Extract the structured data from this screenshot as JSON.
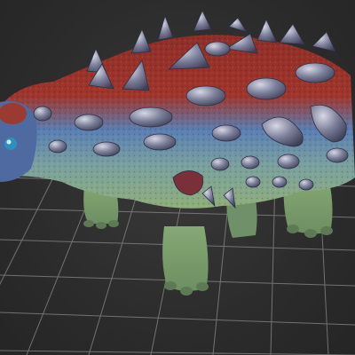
{
  "viewport": {
    "background_color": "#2c2c2c",
    "grid_color": "#8a8a8a",
    "model": {
      "subject": "ankylosaur",
      "colors": {
        "back_red": "#a0352c",
        "flank_blue": "#5a7fb3",
        "belly_green": "#8fae7a",
        "spike": "#6a6d84"
      }
    }
  }
}
